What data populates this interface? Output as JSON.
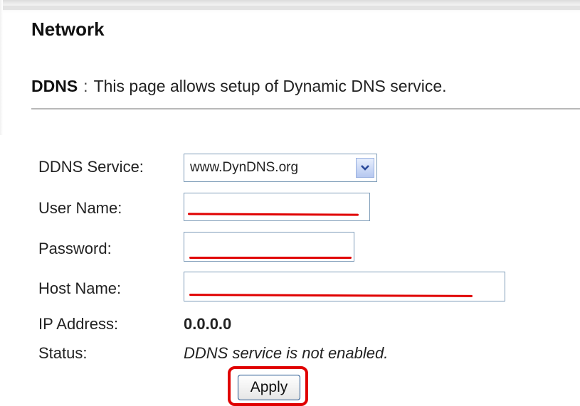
{
  "page": {
    "title": "Network"
  },
  "description": {
    "key": "DDNS",
    "separator": ":",
    "text": "This page allows setup of Dynamic DNS service."
  },
  "form": {
    "ddns_service": {
      "label": "DDNS Service:",
      "selected": "www.DynDNS.org"
    },
    "user_name": {
      "label": "User Name:",
      "value": ""
    },
    "password": {
      "label": "Password:",
      "value": ""
    },
    "host_name": {
      "label": "Host Name:",
      "value": ""
    },
    "ip_address": {
      "label": "IP Address:",
      "value": "0.0.0.0"
    },
    "status": {
      "label": "Status:",
      "value": "DDNS service is not enabled."
    }
  },
  "actions": {
    "apply_label": "Apply"
  },
  "colors": {
    "redaction": "#e00000",
    "highlight": "#e00000",
    "field_border": "#7f9db9"
  },
  "icons": {
    "dropdown": "chevron-down-icon"
  }
}
